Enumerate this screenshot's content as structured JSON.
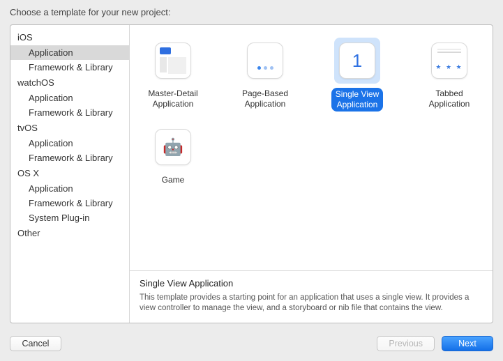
{
  "header": {
    "title": "Choose a template for your new project:"
  },
  "sidebar": {
    "groups": [
      {
        "header": "iOS",
        "items": [
          "Application",
          "Framework & Library"
        ]
      },
      {
        "header": "watchOS",
        "items": [
          "Application",
          "Framework & Library"
        ]
      },
      {
        "header": "tvOS",
        "items": [
          "Application",
          "Framework & Library"
        ]
      },
      {
        "header": "OS X",
        "items": [
          "Application",
          "Framework & Library",
          "System Plug-in"
        ]
      },
      {
        "header": "Other",
        "items": []
      }
    ],
    "selected_group": 0,
    "selected_item": 0
  },
  "templates": [
    {
      "id": "master-detail",
      "label": "Master-Detail\nApplication"
    },
    {
      "id": "page-based",
      "label": "Page-Based\nApplication"
    },
    {
      "id": "single-view",
      "label": "Single View\nApplication",
      "selected": true
    },
    {
      "id": "tabbed",
      "label": "Tabbed\nApplication"
    },
    {
      "id": "game",
      "label": "Game"
    }
  ],
  "description": {
    "title": "Single View Application",
    "body": "This template provides a starting point for an application that uses a single view. It provides a view controller to manage the view, and a storyboard or nib file that contains the view."
  },
  "footer": {
    "cancel": "Cancel",
    "previous": "Previous",
    "next": "Next",
    "previous_enabled": false
  }
}
